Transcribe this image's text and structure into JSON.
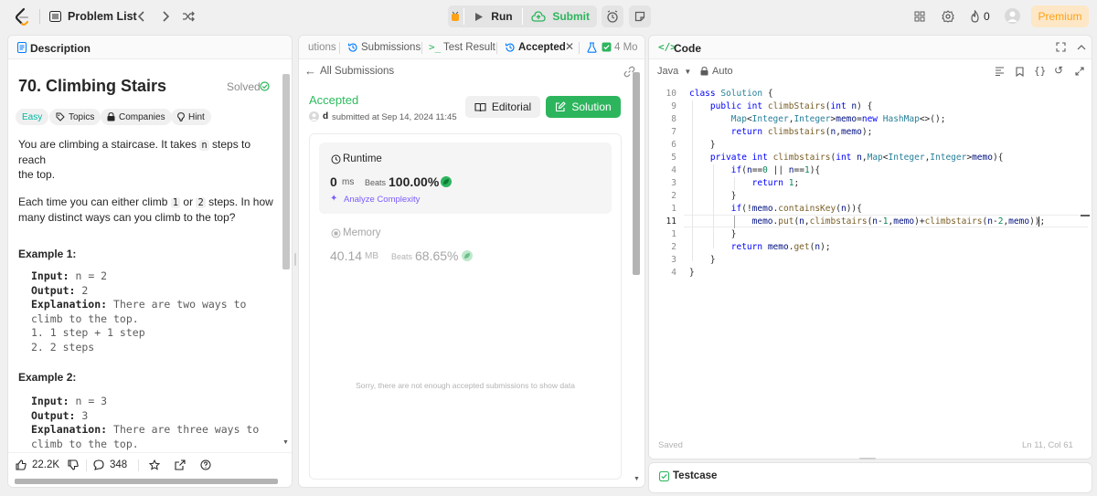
{
  "topbar": {
    "problem_list": "Problem List",
    "run": "Run",
    "submit": "Submit",
    "streak_count": "0",
    "premium": "Premium"
  },
  "description": {
    "tab": "Description",
    "title": "70. Climbing Stairs",
    "solved": "Solved",
    "tags": {
      "difficulty": "Easy",
      "topics": "Topics",
      "companies": "Companies",
      "hint": "Hint"
    },
    "para1_a": "You are climbing a staircase. It takes",
    "para1_code": "n",
    "para1_b": "steps to reach",
    "para1_c": "the top.",
    "para2_a": "Each time you can either climb",
    "para2_code1": "1",
    "para2_or": "or",
    "para2_code2": "2",
    "para2_b": "steps. In how",
    "para2_c": "many distinct ways can you climb to the top?",
    "example1": {
      "heading": "Example 1:",
      "input_label": "Input:",
      "input_value": "n = 2",
      "output_label": "Output:",
      "output_value": "2",
      "explanation_label": "Explanation:",
      "explanation_value": "There are two ways to",
      "explanation_cont": "climb to the top.",
      "step1": "1. 1 step + 1 step",
      "step2": "2. 2 steps"
    },
    "example2": {
      "heading": "Example 2:",
      "input_label": "Input:",
      "input_value": "n = 3",
      "output_label": "Output:",
      "output_value": "3",
      "explanation_label": "Explanation:",
      "explanation_value": "There are three ways to",
      "explanation_cont": "climb to the top."
    },
    "footer": {
      "likes": "22.2K",
      "comments": "348"
    }
  },
  "middle": {
    "tabs": {
      "solutions_partial": "utions",
      "submissions": "Submissions",
      "test_result": "Test Result",
      "accepted": "Accepted",
      "more_partial": "4 Mo"
    },
    "all_submissions": "All Submissions",
    "status": "Accepted",
    "user_initial": "d",
    "submitted_text": "submitted at Sep 14, 2024 11:45",
    "editorial": "Editorial",
    "solution": "Solution",
    "runtime": {
      "label": "Runtime",
      "value": "0",
      "unit": "ms",
      "beats_label": "Beats",
      "beats_value": "100.00%",
      "analyze": "Analyze Complexity"
    },
    "memory": {
      "label": "Memory",
      "value": "40.14",
      "unit": "MB",
      "beats_label": "Beats",
      "beats_value": "68.65%"
    },
    "no_data": "Sorry, there are not enough accepted submissions to show data"
  },
  "code": {
    "tab": "Code",
    "language": "Java",
    "autocomplete": "Auto",
    "line_numbers": [
      "10",
      "9",
      "8",
      "7",
      "6",
      "5",
      "4",
      "3",
      "2",
      "1",
      "11",
      "1",
      "2",
      "3",
      "4"
    ],
    "lines": [
      "class Solution {",
      "    public int climbStairs(int n) {",
      "        Map<Integer,Integer>memo=new HashMap<>();",
      "        return climbstairs(n,memo);",
      "    }",
      "    private int climbstairs(int n,Map<Integer,Integer>memo){",
      "        if(n==0 || n==1){",
      "            return 1;",
      "        }",
      "        if(!memo.containsKey(n)){",
      "            memo.put(n,climbstairs(n-1,memo)+climbstairs(n-2,memo));",
      "        }",
      "        return memo.get(n);",
      "    }",
      "}"
    ],
    "saved": "Saved",
    "cursor": "Ln 11, Col 61"
  },
  "testcase": {
    "tab": "Testcase"
  },
  "colors": {
    "accent_green": "#2db55d",
    "accepted_green": "#2cbb5d",
    "premium_orange": "#ffa116",
    "link_blue": "#007bff"
  }
}
